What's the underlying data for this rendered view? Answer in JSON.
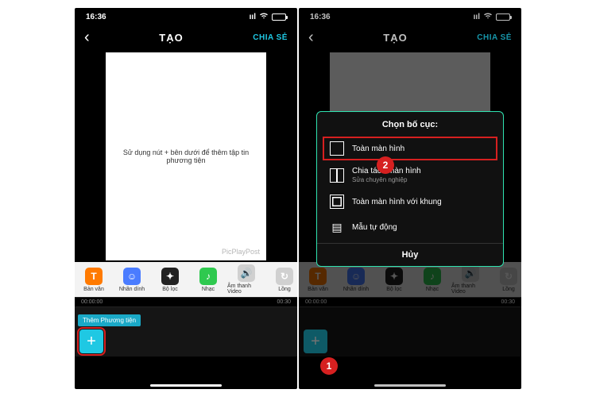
{
  "statusbar": {
    "time": "16:36"
  },
  "header": {
    "title": "TẠO",
    "share": "CHIA SẺ"
  },
  "screen1": {
    "canvas_hint": "Sử dụng nút + bên dưới để thêm tập tin phương tiện",
    "watermark": "PicPlayPost"
  },
  "tools": {
    "text": "Bản văn",
    "sticker": "Nhãn dính",
    "filter": "Bộ lọc",
    "music": "Nhạc",
    "audio": "Âm thanh Video",
    "loop": "Lồng"
  },
  "timeline": {
    "t_start": "00:00:00",
    "t_end": "00:30"
  },
  "add_media": {
    "label": "Thêm Phương tiện",
    "plus": "+"
  },
  "modal": {
    "title": "Chọn bố cục:",
    "item1": "Toàn màn hình",
    "item2": "Chia tách màn hình",
    "item2_sub": "Sửa chuyên nghiệp",
    "item3": "Toàn màn hình với khung",
    "item4": "Mẫu tự động",
    "cancel": "Hủy"
  },
  "callouts": {
    "one": "1",
    "two": "2"
  }
}
